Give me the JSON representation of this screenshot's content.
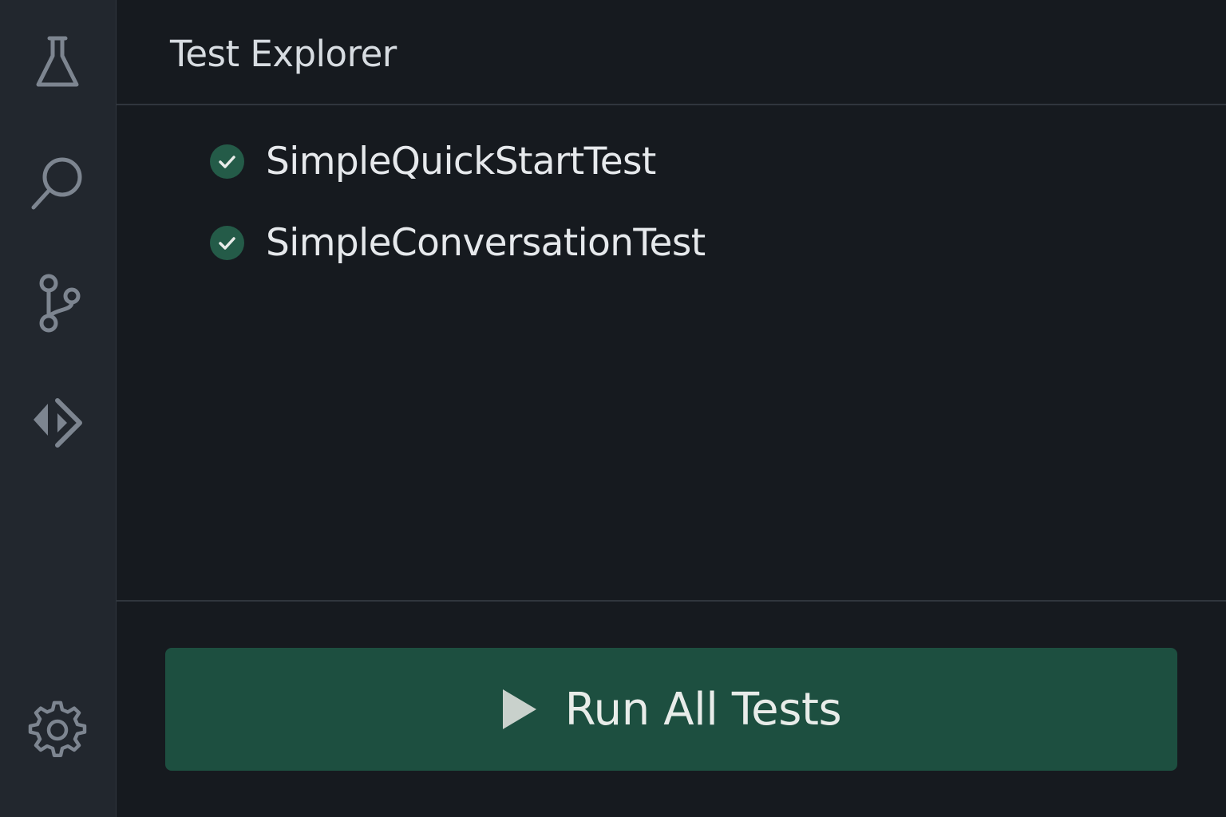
{
  "activity_bar": {
    "items": [
      {
        "name": "testing",
        "icon": "flask-icon"
      },
      {
        "name": "search",
        "icon": "search-icon"
      },
      {
        "name": "source-control",
        "icon": "source-control-icon"
      },
      {
        "name": "run-debug",
        "icon": "run-debug-icon"
      }
    ],
    "settings_icon": "gear-icon"
  },
  "panel": {
    "title": "Test Explorer"
  },
  "tests": [
    {
      "name": "SimpleQuickStartTest",
      "status": "passed",
      "status_icon": "check-circle-icon"
    },
    {
      "name": "SimpleConversationTest",
      "status": "passed",
      "status_icon": "check-circle-icon"
    }
  ],
  "run_button": {
    "label": "Run All Tests",
    "icon": "play-icon"
  },
  "colors": {
    "background": "#161a1f",
    "activity_bar": "#22272e",
    "icon": "#7d8590",
    "accent_green": "#1d4f40",
    "pass_green": "#245b48",
    "text": "#e6e9ec"
  }
}
